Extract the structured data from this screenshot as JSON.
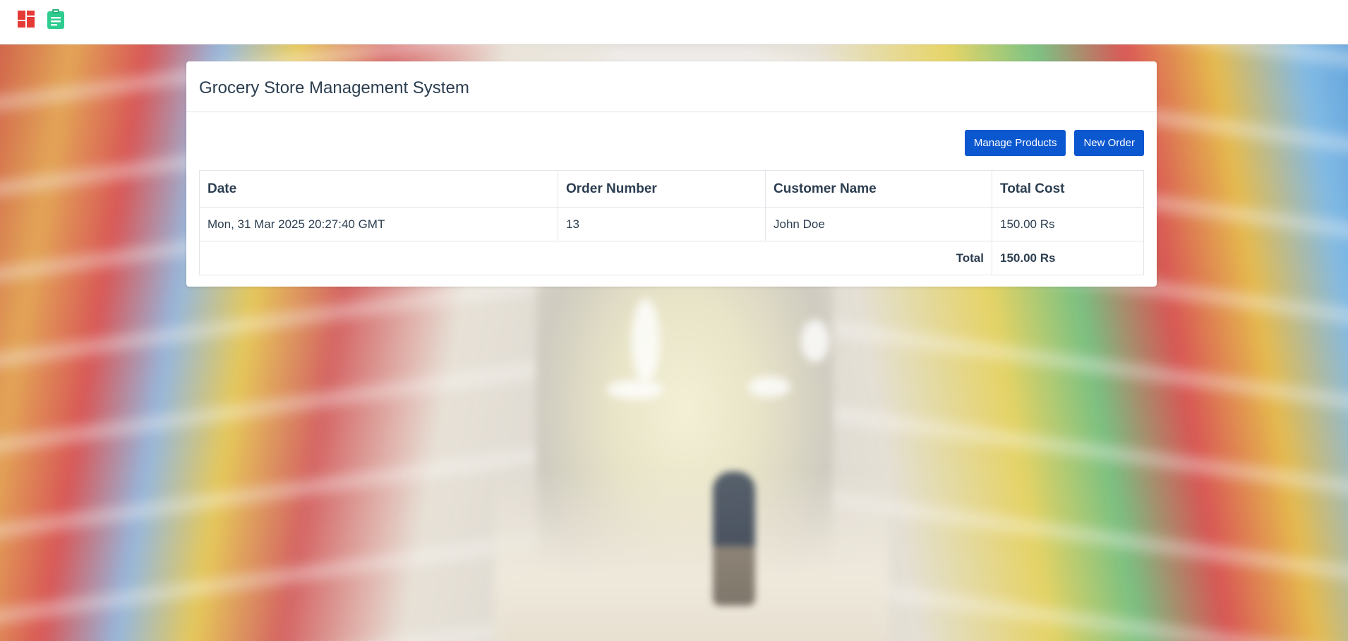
{
  "topbar": {
    "logo_icon": "dashboard-grid-icon",
    "logo_color": "#e53935",
    "orders_icon": "clipboard-icon",
    "orders_color": "#2ecc8f"
  },
  "panel": {
    "title": "Grocery Store Management System",
    "buttons": {
      "manage_products": "Manage Products",
      "new_order": "New Order"
    },
    "accent_color": "#0b57d0"
  },
  "orders_table": {
    "headers": {
      "date": "Date",
      "order_number": "Order Number",
      "customer_name": "Customer Name",
      "total_cost": "Total Cost"
    },
    "rows": [
      {
        "date": "Mon, 31 Mar 2025 20:27:40 GMT",
        "order_number": "13",
        "customer_name": "John Doe",
        "total_cost": "150.00 Rs"
      }
    ],
    "footer": {
      "label": "Total",
      "value": "150.00 Rs"
    }
  }
}
